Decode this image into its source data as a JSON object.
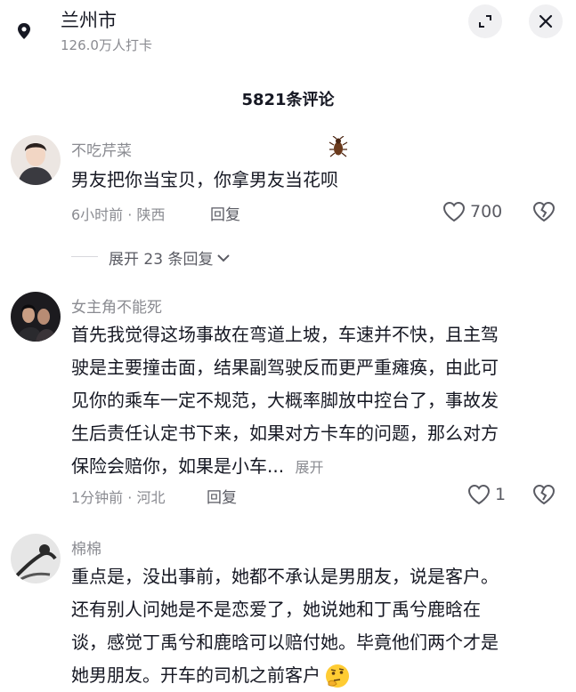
{
  "header": {
    "location_title": "兰州市",
    "location_subtitle": "126.0万人打卡",
    "pin_icon": "location-pin-icon",
    "expand_icon": "expand-icon",
    "close_icon": "close-icon"
  },
  "comment_count": "5821条评论",
  "comments": [
    {
      "username": "不吃芹菜",
      "text_lines": [
        "男友把你当宝贝，你拿男友当花呗"
      ],
      "time_location": "6小时前 · 陕西",
      "reply_label": "回复",
      "like_count": "700",
      "expand_replies": "展开 23 条回复",
      "emoji": "bug"
    },
    {
      "username": "女主角不能死",
      "text_lines": [
        "首先我觉得这场事故在弯道上坡，车速并不快，且主驾",
        "驶是主要撞击面，结果副驾驶反而更严重瘫痪，由此可",
        "见你的乘车一定不规范，大概率脚放中控台了，事故发",
        "生后责任认定书下来，如果对方卡车的问题，那么对方",
        "保险会赔你，如果是小车..."
      ],
      "more_label": "展开",
      "time_location": "1分钟前 · 河北",
      "reply_label": "回复",
      "like_count": "1"
    },
    {
      "username": "棉棉",
      "text_lines": [
        "重点是，没出事前，她都不承认是男朋友，说是客户。",
        "还有别人问她是不是恋爱了，她说她和丁禹兮鹿晗在",
        "谈，感觉丁禹兮和鹿晗可以赔付她。毕竟他们两个才是",
        "她男朋友。开车的司机之前客户"
      ],
      "emoji": "thinking-face"
    }
  ]
}
